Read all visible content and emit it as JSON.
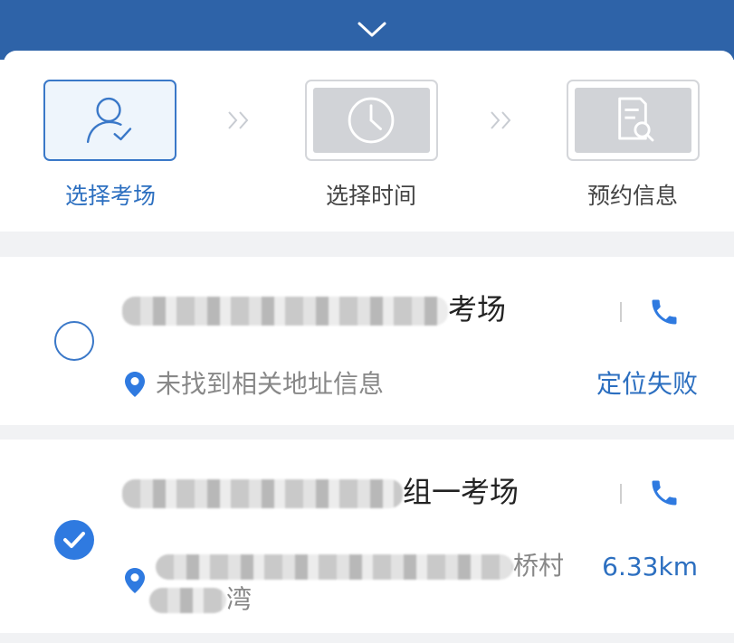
{
  "colors": {
    "brand": "#2e63a8",
    "accent": "#2f7ae0",
    "inactive_step": "#d1d3d7"
  },
  "header": {
    "collapse_icon": "chevron-down-icon"
  },
  "steps": [
    {
      "label": "选择考场",
      "icon": "user-check-icon",
      "state": "active"
    },
    {
      "label": "选择时间",
      "icon": "clock-icon",
      "state": "inactive"
    },
    {
      "label": "预约信息",
      "icon": "document-search-icon",
      "state": "inactive"
    }
  ],
  "venues": [
    {
      "name_suffix": "考场",
      "selected": false,
      "address": "未找到相关地址信息",
      "status": "定位失败",
      "phone_icon": "phone-icon"
    },
    {
      "name_suffix": "组一考场",
      "selected": true,
      "address_tail": "桥村",
      "address_line2_tail": "湾",
      "status": "6.33km",
      "phone_icon": "phone-icon"
    }
  ]
}
